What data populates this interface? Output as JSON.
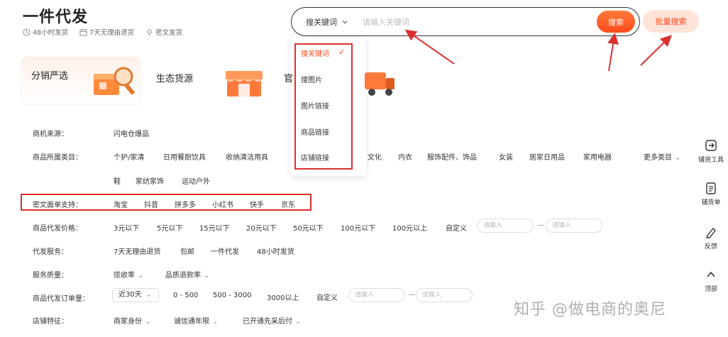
{
  "brand": "一件代发",
  "features": [
    {
      "icon": "clock-icon",
      "label": "48小时发货"
    },
    {
      "icon": "calendar-icon",
      "label": "7天无理由退货"
    },
    {
      "icon": "pin-icon",
      "label": "密文发货"
    }
  ],
  "search": {
    "type_label": "搜关键词",
    "placeholder": "请输入关键词",
    "button_label": "搜索",
    "batch_label": "批量搜索",
    "dropdown": [
      "搜关键词",
      "搜图片",
      "图片链接",
      "商品链接",
      "店铺链接"
    ]
  },
  "tabs": [
    {
      "label": "分销严选"
    },
    {
      "label": "生态货源"
    },
    {
      "label": "官"
    }
  ],
  "filters": {
    "source": {
      "label": "商机来源：",
      "options": [
        "闪电仓爆品"
      ]
    },
    "category": {
      "label": "商品所属类目：",
      "options": [
        "个护/家清",
        "日用餐厨饮具",
        "收纳清洁用具",
        "文化",
        "内衣",
        "服饰配件、饰品",
        "女装",
        "居家日用品",
        "家用电器"
      ],
      "more": "更多类目",
      "options_row2": [
        "鞋",
        "家纺家饰",
        "运动户外"
      ]
    },
    "miwen": {
      "label": "密文面单支持：",
      "options": [
        "淘宝",
        "抖音",
        "拼多多",
        "小红书",
        "快手",
        "京东"
      ]
    },
    "price": {
      "label": "商品代发价格：",
      "options": [
        "3元以下",
        "5元以下",
        "15元以下",
        "20元以下",
        "50元以下",
        "100元以下",
        "100元以上",
        "自定义"
      ],
      "input_placeholder_min": "请输入",
      "input_placeholder_max": "请输入",
      "dash": "—"
    },
    "service": {
      "label": "代发服务：",
      "options": [
        "7天无理由退货",
        "包邮",
        "一件代发",
        "48小时发货"
      ]
    },
    "quality": {
      "label": "服务质量：",
      "options": [
        "揽收率",
        "品质退款率"
      ]
    },
    "orders": {
      "label": "商品代发订单量：",
      "select": "近30天",
      "options": [
        "0 - 500",
        "500 - 3000",
        "3000以上",
        "自定义"
      ],
      "input_placeholder_min": "请输入",
      "input_placeholder_max": "请输入",
      "dash": "—"
    },
    "shop": {
      "label": "店铺特征：",
      "options": [
        "商家身份",
        "诚信通年限",
        "已开通先采后付"
      ]
    }
  },
  "sidebar": [
    {
      "icon": "tool-icon",
      "label": "铺货工具"
    },
    {
      "icon": "list-icon",
      "label": "铺货单"
    },
    {
      "icon": "pen-icon",
      "label": "反馈"
    },
    {
      "icon": "up-icon",
      "label": "顶部"
    }
  ],
  "watermark": "知乎 @做电商的奥尼",
  "colors": {
    "accent": "#ff4a1a",
    "annotation": "#d9302f"
  }
}
